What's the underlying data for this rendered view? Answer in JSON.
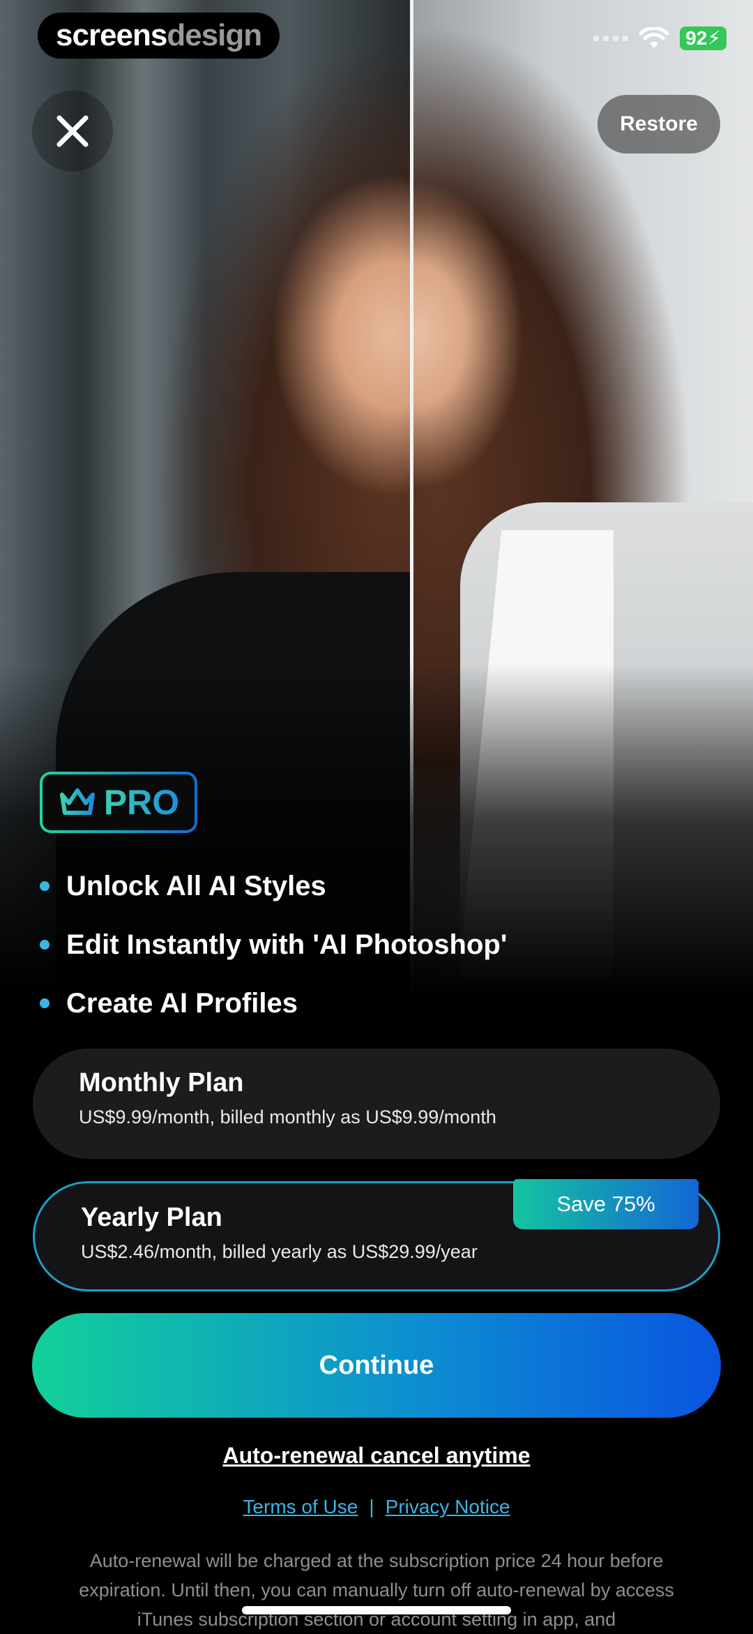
{
  "watermark": {
    "part1": "screens",
    "part2": "design"
  },
  "status_bar": {
    "battery": "92"
  },
  "top_bar": {
    "restore_label": "Restore"
  },
  "pro_badge": {
    "label": "PRO"
  },
  "features": [
    "Unlock All AI Styles",
    "Edit Instantly with 'AI Photoshop'",
    "Create AI Profiles"
  ],
  "plans": {
    "monthly": {
      "title": "Monthly Plan",
      "description": "US$9.99/month, billed monthly as US$9.99/month"
    },
    "yearly": {
      "title": "Yearly Plan",
      "description": "US$2.46/month, billed yearly as US$29.99/year",
      "badge": "Save 75%",
      "selected": true
    }
  },
  "continue_label": "Continue",
  "auto_renewal_label": "Auto-renewal cancel anytime",
  "links": {
    "terms": "Terms of Use",
    "separator": "|",
    "privacy": "Privacy Notice"
  },
  "legal_text": "Auto-renewal will be charged at the subscription price 24 hour before expiration. Until then, you can manually turn off auto-renewal by access iTunes subscription section or account setting in app, and",
  "colors": {
    "accent_cyan": "#38b6e6",
    "gradient_start": "#12d09a",
    "gradient_end": "#0a55e0",
    "card": "#1c1c1e"
  },
  "icons": {
    "close": "close-icon",
    "crown": "crown-icon",
    "wifi": "wifi-icon",
    "battery": "battery-icon"
  }
}
